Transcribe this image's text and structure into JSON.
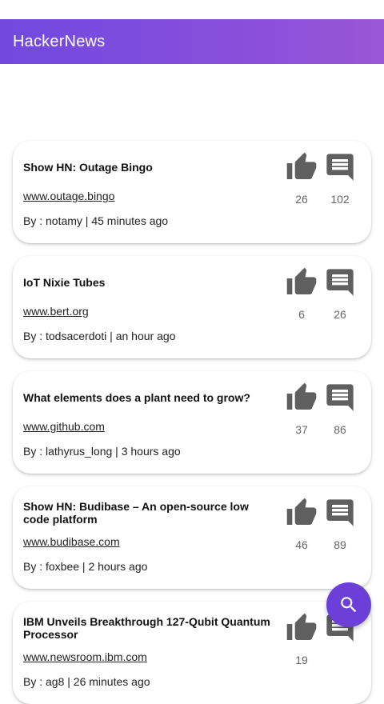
{
  "app": {
    "title": "HackerNews"
  },
  "stories": [
    {
      "title": "Show HN: Outage Bingo",
      "url": "www.outage.bingo",
      "meta": "By : notamy | 45 minutes ago",
      "likes": "26",
      "comments": "102"
    },
    {
      "title": "IoT Nixie Tubes",
      "url": "www.bert.org",
      "meta": "By : todsacerdoti | an hour ago",
      "likes": "6",
      "comments": "26"
    },
    {
      "title": "What elements does a plant need to grow?",
      "url": "www.github.com",
      "meta": "By : lathyrus_long | 3 hours ago",
      "likes": "37",
      "comments": "86"
    },
    {
      "title": "Show HN: Budibase – An open-source low code platform",
      "url": "www.budibase.com",
      "meta": "By : foxbee | 2 hours ago",
      "likes": "46",
      "comments": "89"
    },
    {
      "title": "IBM Unveils Breakthrough 127-Qubit Quantum Processor",
      "url": "www.newsroom.ibm.com",
      "meta": "By : ag8 | 26 minutes ago",
      "likes": "19",
      "comments": ""
    }
  ],
  "icons": {
    "like": "thumb-up-icon",
    "comment": "comment-icon",
    "fab": "search-icon"
  },
  "colors": {
    "icon": "#5f5f5f",
    "app_bar_start": "#7049df",
    "app_bar_end": "#9a57d6",
    "fab": "#6b3fd8"
  }
}
